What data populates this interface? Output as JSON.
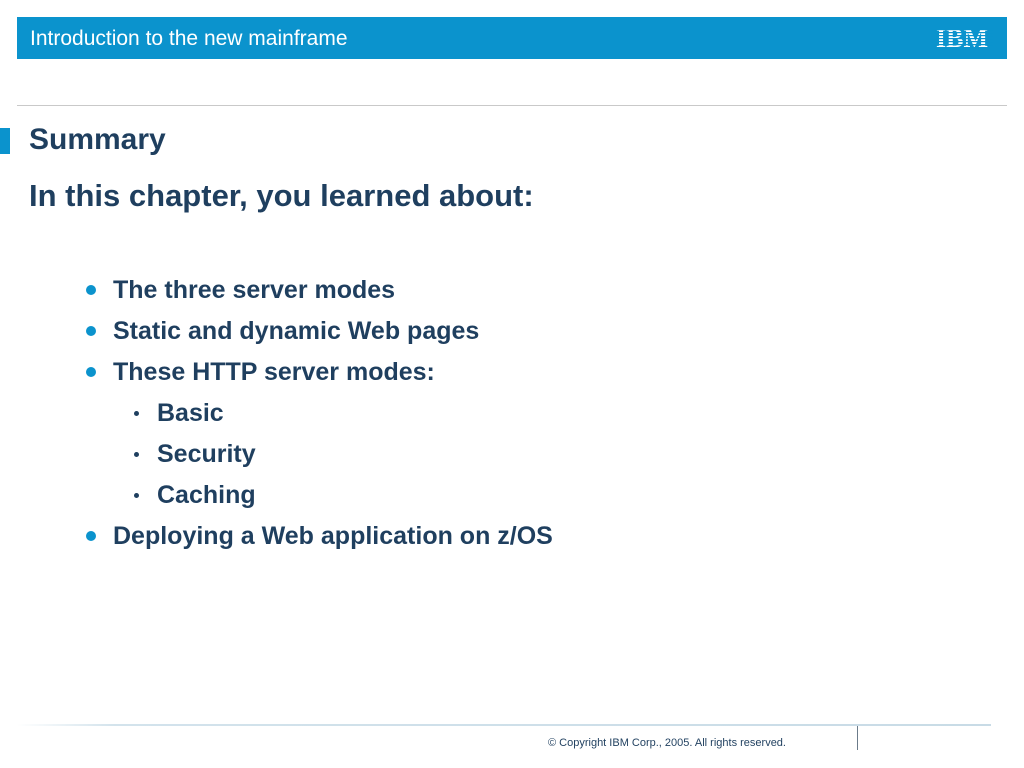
{
  "header": {
    "title": "Introduction to the new mainframe",
    "logo": "IBM"
  },
  "content": {
    "heading": "Summary",
    "subheading": "In this chapter, you learned about:",
    "bullets": [
      "The three server modes",
      "Static and dynamic Web pages",
      "These HTTP server modes:",
      "Deploying a Web application on z/OS"
    ],
    "sub_bullets": [
      "Basic",
      "Security",
      "Caching"
    ]
  },
  "footer": {
    "copyright": "© Copyright IBM Corp., 2005. All rights reserved."
  },
  "colors": {
    "accent": "#0b93cd",
    "text": "#1f3f5f"
  }
}
